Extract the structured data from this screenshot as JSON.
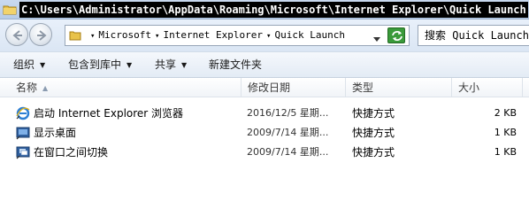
{
  "window": {
    "title": "C:\\Users\\Administrator\\AppData\\Roaming\\Microsoft\\Internet Explorer\\Quick Launch",
    "icon": "folder-icon"
  },
  "address_bar": {
    "breadcrumbs": [
      "Microsoft",
      "Internet Explorer",
      "Quick Launch"
    ],
    "refresh_icon": "refresh-icon"
  },
  "search": {
    "placeholder": "搜索 Quick Launch"
  },
  "toolbar": {
    "organize": "组织",
    "include_in_library": "包含到库中",
    "share": "共享",
    "new_folder": "新建文件夹"
  },
  "columns": {
    "name": "名称",
    "date_modified": "修改日期",
    "type": "类型",
    "size": "大小"
  },
  "files": [
    {
      "name": "启动 Internet Explorer 浏览器",
      "date": "2016/12/5 星期...",
      "type": "快捷方式",
      "size": "2 KB",
      "icon": "internet-explorer-icon"
    },
    {
      "name": "显示桌面",
      "date": "2009/7/14 星期...",
      "type": "快捷方式",
      "size": "1 KB",
      "icon": "show-desktop-icon"
    },
    {
      "name": "在窗口之间切换",
      "date": "2009/7/14 星期...",
      "type": "快捷方式",
      "size": "1 KB",
      "icon": "switch-windows-icon"
    }
  ],
  "colors": {
    "titlebar_bg": "#b7cce8",
    "refresh_green": "#3a9a3a"
  }
}
